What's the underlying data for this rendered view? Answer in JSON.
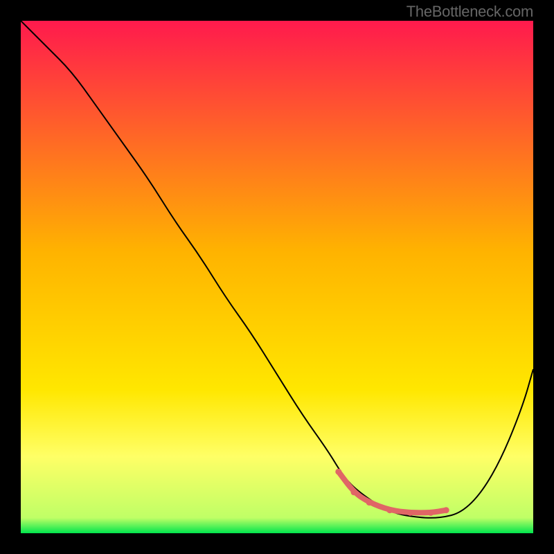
{
  "attribution": "TheBottleneck.com",
  "chart_data": {
    "type": "line",
    "title": "",
    "xlabel": "",
    "ylabel": "",
    "xlim": [
      0,
      100
    ],
    "ylim": [
      0,
      100
    ],
    "background": {
      "type": "vertical-gradient",
      "stops": [
        {
          "offset": 0,
          "color": "#ff1a4d"
        },
        {
          "offset": 45,
          "color": "#ffb300"
        },
        {
          "offset": 72,
          "color": "#ffe700"
        },
        {
          "offset": 85,
          "color": "#ffff66"
        },
        {
          "offset": 97,
          "color": "#bfff66"
        },
        {
          "offset": 100,
          "color": "#00e64d"
        }
      ]
    },
    "series": [
      {
        "name": "bottleneck-curve",
        "color": "#000000",
        "width": 2,
        "x": [
          0,
          5,
          10,
          15,
          20,
          25,
          30,
          35,
          40,
          45,
          50,
          55,
          60,
          63,
          66,
          72,
          78,
          82,
          86,
          90,
          94,
          98,
          100
        ],
        "y": [
          100,
          95,
          90,
          83,
          76,
          69,
          61,
          54,
          46,
          39,
          31,
          23,
          16,
          11,
          8,
          4,
          3,
          3,
          4,
          8,
          15,
          25,
          32
        ]
      },
      {
        "name": "highlight-region",
        "color": "#e06666",
        "width": 8,
        "linecap": "round",
        "x": [
          62,
          65,
          68,
          72,
          76,
          80,
          83
        ],
        "y": [
          12,
          8,
          6,
          4.5,
          4,
          4,
          4.5
        ]
      }
    ]
  }
}
